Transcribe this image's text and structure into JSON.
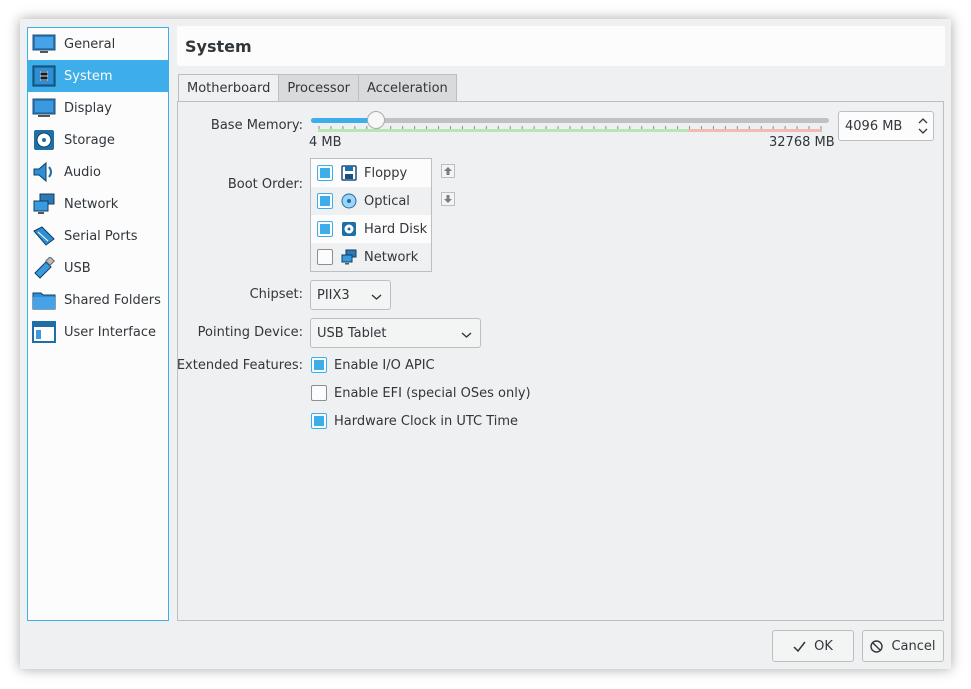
{
  "sidebar": {
    "items": [
      {
        "label": "General",
        "icon": "general-icon",
        "selected": false
      },
      {
        "label": "System",
        "icon": "system-icon",
        "selected": true
      },
      {
        "label": "Display",
        "icon": "display-icon",
        "selected": false
      },
      {
        "label": "Storage",
        "icon": "storage-icon",
        "selected": false
      },
      {
        "label": "Audio",
        "icon": "audio-icon",
        "selected": false
      },
      {
        "label": "Network",
        "icon": "network-icon",
        "selected": false
      },
      {
        "label": "Serial Ports",
        "icon": "serial-ports-icon",
        "selected": false
      },
      {
        "label": "USB",
        "icon": "usb-icon",
        "selected": false
      },
      {
        "label": "Shared Folders",
        "icon": "shared-folders-icon",
        "selected": false
      },
      {
        "label": "User Interface",
        "icon": "user-interface-icon",
        "selected": false
      }
    ]
  },
  "header": {
    "title": "System"
  },
  "tabs": [
    {
      "label": "Motherboard",
      "active": true
    },
    {
      "label": "Processor",
      "active": false
    },
    {
      "label": "Acceleration",
      "active": false
    }
  ],
  "motherboard": {
    "base_memory": {
      "label": "Base Memory:",
      "min_label": "4 MB",
      "max_label": "32768 MB",
      "value": "4096 MB",
      "fraction": 0.125
    },
    "boot_order": {
      "label": "Boot Order:",
      "items": [
        {
          "label": "Floppy",
          "checked": true,
          "icon": "floppy-icon"
        },
        {
          "label": "Optical",
          "checked": true,
          "icon": "optical-disc-icon"
        },
        {
          "label": "Hard Disk",
          "checked": true,
          "icon": "hard-disk-icon"
        },
        {
          "label": "Network",
          "checked": false,
          "icon": "network-icon"
        }
      ]
    },
    "chipset": {
      "label": "Chipset:",
      "value": "PIIX3"
    },
    "pointing_device": {
      "label": "Pointing Device:",
      "value": "USB Tablet"
    },
    "extended_features": {
      "label": "Extended Features:",
      "options": [
        {
          "label": "Enable I/O APIC",
          "checked": true
        },
        {
          "label": "Enable EFI (special OSes only)",
          "checked": false
        },
        {
          "label": "Hardware Clock in UTC Time",
          "checked": true
        }
      ]
    }
  },
  "buttons": {
    "ok": "OK",
    "cancel": "Cancel"
  },
  "colors": {
    "accent": "#3daee9",
    "safe_range": "#b5e8b0",
    "warn_range": "#f4b9b0"
  }
}
